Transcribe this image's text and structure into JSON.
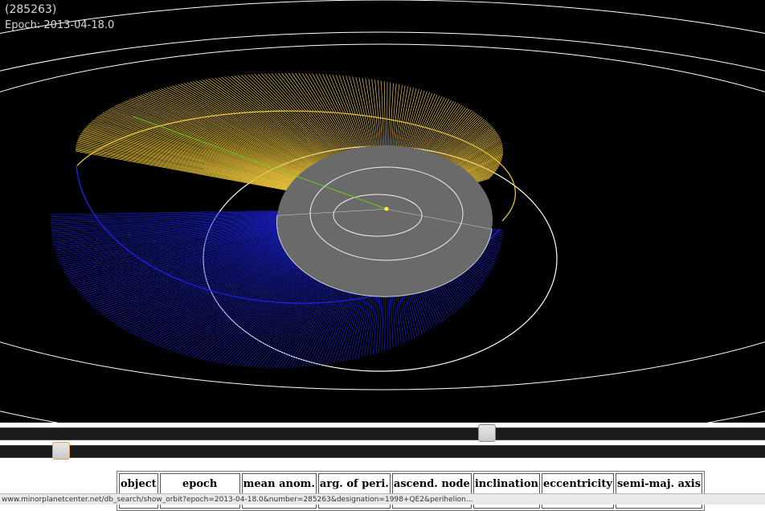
{
  "viewer": {
    "object_name": "(285263)",
    "epoch_text": "Epoch: 2013-04-18.0"
  },
  "colors": {
    "background": "#000000",
    "orbit_upper": "#e8c23a",
    "orbit_lower": "#1a22d0",
    "inner_disc": "#6a6a6a",
    "planet_orbits": "#ffffff",
    "perihelion_line": "#6bd11a",
    "sun": "#ffff33"
  },
  "sliders": {
    "view_angle_value": 0.64,
    "zoom_value": 0.07
  },
  "table": {
    "headers": [
      "object",
      "epoch",
      "mean anom.",
      "arg. of peri.",
      "ascend. node",
      "inclination",
      "eccentricity",
      "semi-maj. axis"
    ]
  },
  "status_bar": {
    "text": "www.minorplanetcenter.net/db_search/show_orbit?epoch=2013-04-18.0&number=285263&designation=1998+QE2&perihelion..."
  }
}
